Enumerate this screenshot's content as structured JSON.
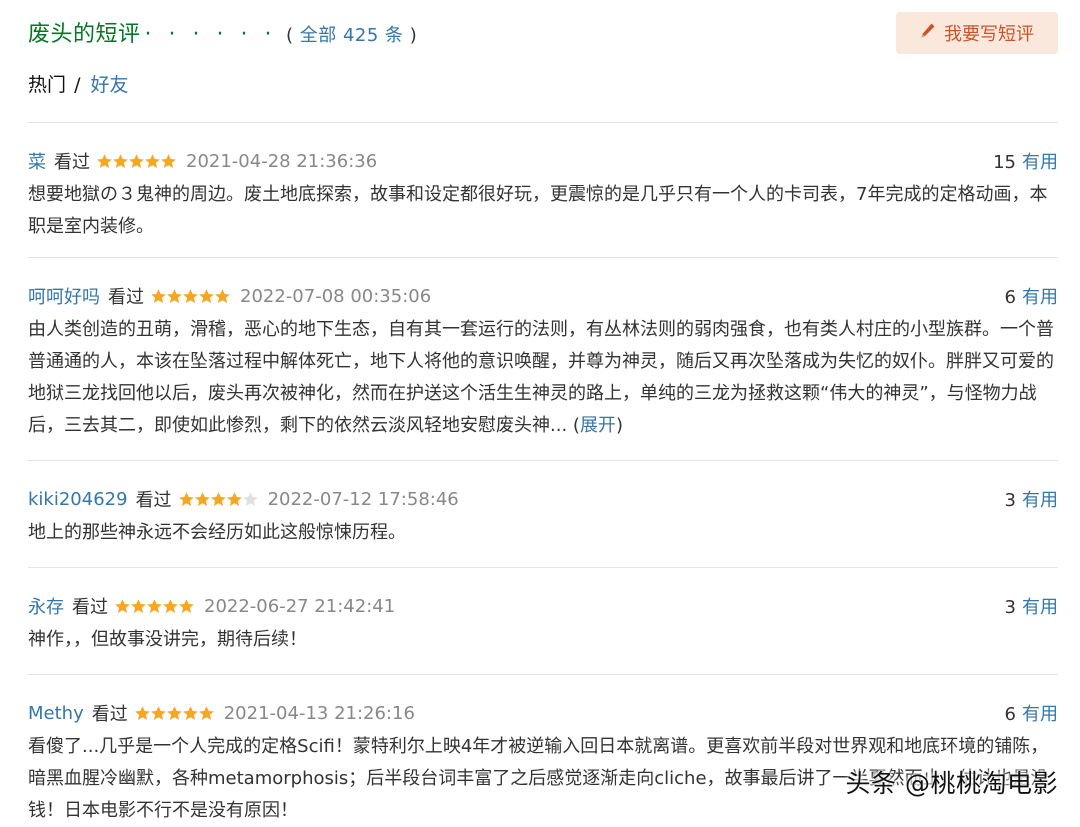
{
  "header": {
    "title": "废头的短评",
    "dots": "· · · · · ·",
    "count_open": "(",
    "count_text": "全部 425 条",
    "count_close": ")",
    "write_button": "我要写短评",
    "write_icon": "pencil-icon"
  },
  "tabs": {
    "hot": "热门",
    "separator": "/",
    "friends": "好友"
  },
  "star_colors": {
    "filled": "#f5a623",
    "empty": "#e0e0e0"
  },
  "comments": [
    {
      "user": "菜",
      "status": "看过",
      "rating": 5,
      "time": "2021-04-28 21:36:36",
      "votes": "15",
      "useful": "有用",
      "text": "想要地獄の３鬼神的周边。废土地底探索，故事和设定都很好玩，更震惊的是几乎只有一个人的卡司表，7年完成的定格动画，本职是室内装修。"
    },
    {
      "user": "呵呵好吗",
      "status": "看过",
      "rating": 5,
      "time": "2022-07-08 00:35:06",
      "votes": "6",
      "useful": "有用",
      "text": "由人类创造的丑萌，滑稽，恶心的地下生态，自有其一套运行的法则，有丛林法则的弱肉强食，也有类人村庄的小型族群。一个普普通通的人，本该在坠落过程中解体死亡，地下人将他的意识唤醒，并尊为神灵，随后又再次坠落成为失忆的奴仆。胖胖又可爱的地狱三龙找回他以后，废头再次被神化，然而在护送这个活生生神灵的路上，单纯的三龙为拯救这颗“伟大的神灵”，与怪物力战后，三去其二，即使如此惨烈，剩下的依然云淡风轻地安慰废头神...",
      "expand_open": "(",
      "expand": "展开",
      "expand_close": ")"
    },
    {
      "user": "kiki204629",
      "status": "看过",
      "rating": 4,
      "time": "2022-07-12 17:58:46",
      "votes": "3",
      "useful": "有用",
      "text": "地上的那些神永远不会经历如此这般惊悚历程。"
    },
    {
      "user": "永存",
      "status": "看过",
      "rating": 5,
      "time": "2022-06-27 21:42:41",
      "votes": "3",
      "useful": "有用",
      "text": "神作，，但故事没讲完，期待后续！"
    },
    {
      "user": "Methy",
      "status": "看过",
      "rating": 5,
      "time": "2021-04-13 21:26:16",
      "votes": "6",
      "useful": "有用",
      "text": "看傻了...几乎是一个人完成的定格Scifi！蒙特利尔上映4年才被逆输入回日本就离谱。更喜欢前半段对世界观和地底环境的铺陈，暗黑血腥冷幽默，各种metamorphosis；后半段台词丰富了之后感觉逐渐走向cliche，故事最后讲了一半戛然而止，估计也是没钱！日本电影不行不是没有原因！"
    }
  ],
  "watermark": "头条 @桃桃淘电影"
}
